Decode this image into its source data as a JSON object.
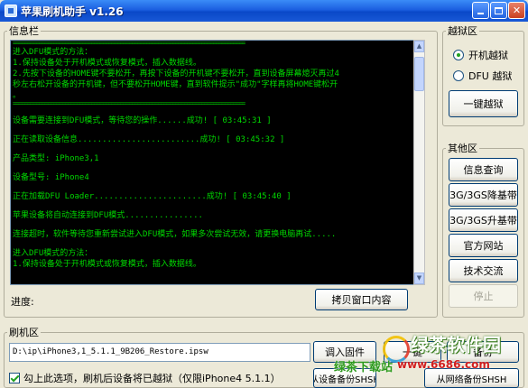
{
  "window": {
    "title": "苹果刷机助手 v1.26"
  },
  "info_panel": {
    "legend": "信息栏",
    "console_lines": [
      {
        "kind": "sep",
        "text": "================================================================================"
      },
      {
        "kind": "text",
        "text": "进入DFU模式的方法："
      },
      {
        "kind": "text",
        "text": "1.保持设备处于开机模式或恢复模式，插入数据线。"
      },
      {
        "kind": "text",
        "text": "2.先按下设备的HOME键不要松开，再按下设备的开机键不要松开，直到设备屏幕熄灭再过4"
      },
      {
        "kind": "text",
        "text": "秒左右松开设备的开机键，但不要松开HOME键，直到软件提示\"成功\"字样再将HOME键松开"
      },
      {
        "kind": "text",
        "text": "。"
      },
      {
        "kind": "sep",
        "text": "================================================================================"
      },
      {
        "kind": "gap",
        "text": ""
      },
      {
        "kind": "text",
        "text": "设备需要连接到DFU模式，等待您的操作......成功!   [ 03:45:31 ]"
      },
      {
        "kind": "gap",
        "text": ""
      },
      {
        "kind": "text",
        "text": "正在读取设备信息.........................成功!   [ 03:45:32 ]"
      },
      {
        "kind": "gap",
        "text": ""
      },
      {
        "kind": "text",
        "text": "产品类型: iPhone3,1"
      },
      {
        "kind": "gap",
        "text": ""
      },
      {
        "kind": "text",
        "text": "设备型号: iPhone4"
      },
      {
        "kind": "gap",
        "text": ""
      },
      {
        "kind": "text",
        "text": "正在加载DFU Loader.......................成功!   [ 03:45:40 ]"
      },
      {
        "kind": "gap",
        "text": ""
      },
      {
        "kind": "text",
        "text": "苹果设备将自动连接到DFU模式................"
      },
      {
        "kind": "gap",
        "text": ""
      },
      {
        "kind": "text",
        "text": "连接超时，软件等待您重新尝试进入DFU模式，如果多次尝试无效，请更换电脑再试....."
      },
      {
        "kind": "gap",
        "text": ""
      },
      {
        "kind": "text",
        "text": "进入DFU模式的方法："
      },
      {
        "kind": "text",
        "text": "1.保持设备处于开机模式或恢复模式，插入数据线。"
      }
    ],
    "progress_label": "进度:",
    "copy_button": "拷贝窗口内容"
  },
  "jailbreak_panel": {
    "legend": "越狱区",
    "options": [
      {
        "label": "开机越狱",
        "checked": true
      },
      {
        "label": "DFU 越狱",
        "checked": false
      }
    ],
    "one_click_button": "一键越狱"
  },
  "other_panel": {
    "legend": "其他区",
    "buttons": [
      {
        "label": "信息查询",
        "enabled": true
      },
      {
        "label": "3G/3GS降基带",
        "enabled": true
      },
      {
        "label": "3G/3GS升基带",
        "enabled": true
      },
      {
        "label": "官方网站",
        "enabled": true
      },
      {
        "label": "技术交流",
        "enabled": true
      },
      {
        "label": "停止",
        "enabled": false
      }
    ]
  },
  "flash_panel": {
    "legend": "刷机区",
    "firmware_path": "D:\\ip\\iPhone3,1_5.1.1_9B206_Restore.ipsw",
    "load_firmware_button": "调入固件",
    "button2": "一键",
    "button3": "备份",
    "shsh_device_button": "从设备备份SHSH",
    "shsh_network_button": "从网络备份SHSH",
    "keep_jailbreak_checkbox": {
      "label": "勾上此选项，刷机后设备将已越狱（仅限iPhone4 5.1.1）",
      "checked": true
    }
  },
  "watermark": {
    "brand": "绿茶软件园",
    "tagline": "绿茶下载站",
    "url": "www.6686.com"
  }
}
